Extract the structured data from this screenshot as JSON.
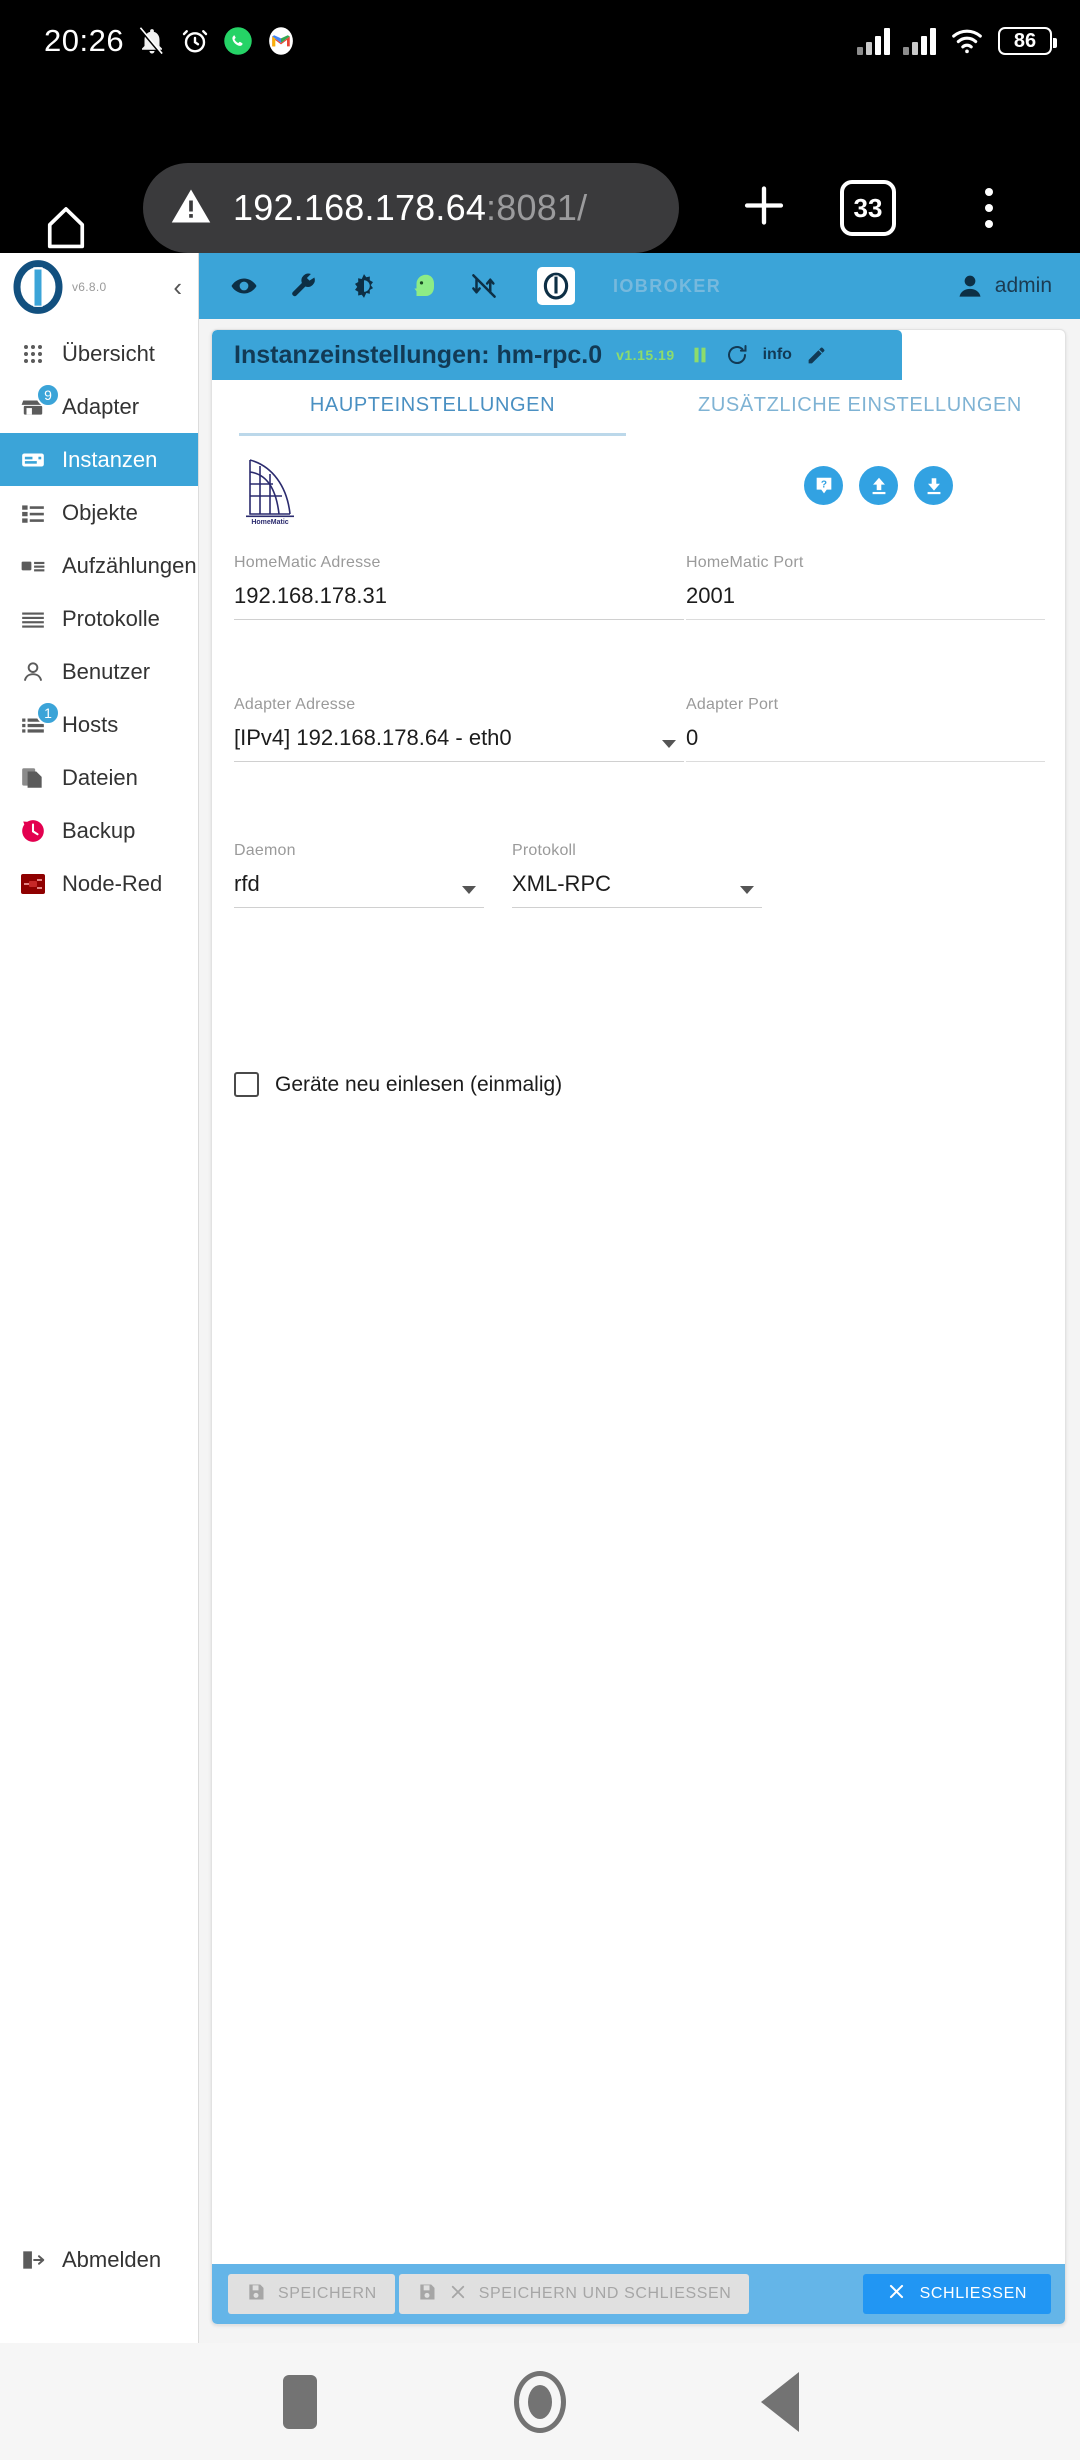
{
  "status_bar": {
    "clock": "20:26",
    "battery": "86",
    "icons": [
      "notifications-off-icon",
      "alarm-icon",
      "whatsapp-icon",
      "gmail-icon",
      "signal-icon",
      "signal-icon",
      "wifi-icon",
      "battery-icon"
    ]
  },
  "browser": {
    "url_host": "192.168.178.64",
    "url_port": ":8081/",
    "tab_count": "33",
    "home_label": "home-icon",
    "new_tab_label": "+",
    "security_icon": "warning-icon"
  },
  "sidebar": {
    "version": "v6.8.0",
    "collapse_icon": "chevron-left-icon",
    "items": [
      {
        "label": "Übersicht",
        "icon": "apps-grid-icon",
        "badge": "",
        "active": false
      },
      {
        "label": "Adapter",
        "icon": "store-icon",
        "badge": "9",
        "active": false
      },
      {
        "label": "Instanzen",
        "icon": "instances-icon",
        "badge": "",
        "active": true
      },
      {
        "label": "Objekte",
        "icon": "list-icon",
        "badge": "",
        "active": false
      },
      {
        "label": "Aufzählungen",
        "icon": "enum-icon",
        "badge": "",
        "active": false
      },
      {
        "label": "Protokolle",
        "icon": "lines-icon",
        "badge": "",
        "active": false
      },
      {
        "label": "Benutzer",
        "icon": "person-icon",
        "badge": "",
        "active": false
      },
      {
        "label": "Hosts",
        "icon": "server-icon",
        "badge": "1",
        "active": false
      },
      {
        "label": "Dateien",
        "icon": "files-icon",
        "badge": "",
        "active": false
      },
      {
        "label": "Backup",
        "icon": "history-icon",
        "badge": "",
        "active": false
      },
      {
        "label": "Node-Red",
        "icon": "nodered-icon",
        "badge": "",
        "active": false
      }
    ],
    "logout_label": "Abmelden",
    "logout_icon": "logout-icon"
  },
  "appbar": {
    "tools": [
      "eye-icon",
      "wrench-icon",
      "contrast-icon",
      "expert-head-icon",
      "sync-off-icon"
    ],
    "brand": "IOBROKER",
    "user": "admin",
    "user_icon": "account-icon"
  },
  "instance": {
    "title": "Instanzeinstellungen: hm-rpc.0",
    "version": "v1.15.19",
    "pause_icon": "pause-icon",
    "refresh_icon": "refresh-icon",
    "info_label": "info",
    "edit_icon": "pencil-icon"
  },
  "tabs": [
    {
      "label": "HAUPTEINSTELLUNGEN",
      "selected": true
    },
    {
      "label": "ZUSÄTZLICHE EINSTELLUNGEN",
      "selected": false
    }
  ],
  "adapter_logo": {
    "name": "homematic-logo",
    "caption": "HomeMatic"
  },
  "action_buttons": [
    {
      "name": "help-button",
      "icon": "question-mark-icon"
    },
    {
      "name": "upload-button",
      "icon": "arrow-up-icon"
    },
    {
      "name": "download-button",
      "icon": "arrow-down-icon"
    }
  ],
  "form": {
    "homematic_address": {
      "label": "HomeMatic Adresse",
      "value": "192.168.178.31"
    },
    "homematic_port": {
      "label": "HomeMatic Port",
      "value": "2001"
    },
    "adapter_address": {
      "label": "Adapter Adresse",
      "value": "[IPv4] 192.168.178.64 - eth0"
    },
    "adapter_port": {
      "label": "Adapter Port",
      "value": "0"
    },
    "daemon": {
      "label": "Daemon",
      "value": "rfd"
    },
    "protocol": {
      "label": "Protokoll",
      "value": "XML-RPC"
    },
    "rescan": {
      "label": "Geräte neu einlesen (einmalig)",
      "checked": false
    }
  },
  "footer": {
    "save_label": "SPEICHERN",
    "save_close_label": "SPEICHERN UND SCHLIESSEN",
    "close_label": "SCHLIESSEN",
    "save_icon": "floppy-icon",
    "close_icon": "x-icon"
  },
  "android_nav": {
    "recents": "recents-square-icon",
    "home": "home-circle-icon",
    "back": "back-triangle-icon"
  },
  "colors": {
    "accent": "#3ba4d8",
    "primary_button": "#2196f3",
    "footer_bar": "#64b5e8",
    "title_text": "#123a55",
    "version_green": "#8ddc6c",
    "tab_text": "#4a90c2",
    "badge": "#3ba4d8"
  }
}
